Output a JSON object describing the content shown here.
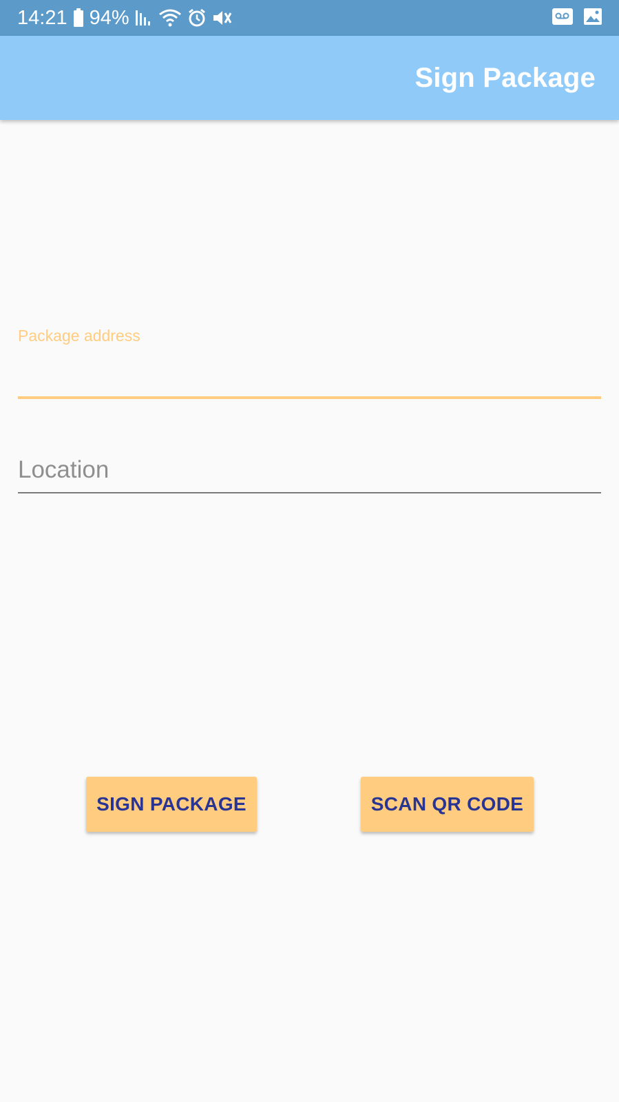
{
  "status_bar": {
    "time": "14:21",
    "battery": "94%",
    "icons": [
      "battery-icon",
      "signal-icon",
      "wifi-icon",
      "alarm-icon",
      "vibrate-icon",
      "voicemail-icon",
      "image-icon"
    ]
  },
  "app_bar": {
    "title": "Sign Package"
  },
  "form": {
    "package_address": {
      "label": "Package address",
      "value": ""
    },
    "location": {
      "placeholder": "Location",
      "value": ""
    }
  },
  "buttons": {
    "sign_label": "SIGN PACKAGE",
    "scan_label": "SCAN QR CODE"
  },
  "colors": {
    "status_bar": "#5b9ac9",
    "app_bar": "#90caf9",
    "accent": "#ffcc80",
    "button_text": "#283593",
    "background": "#fafafa"
  }
}
